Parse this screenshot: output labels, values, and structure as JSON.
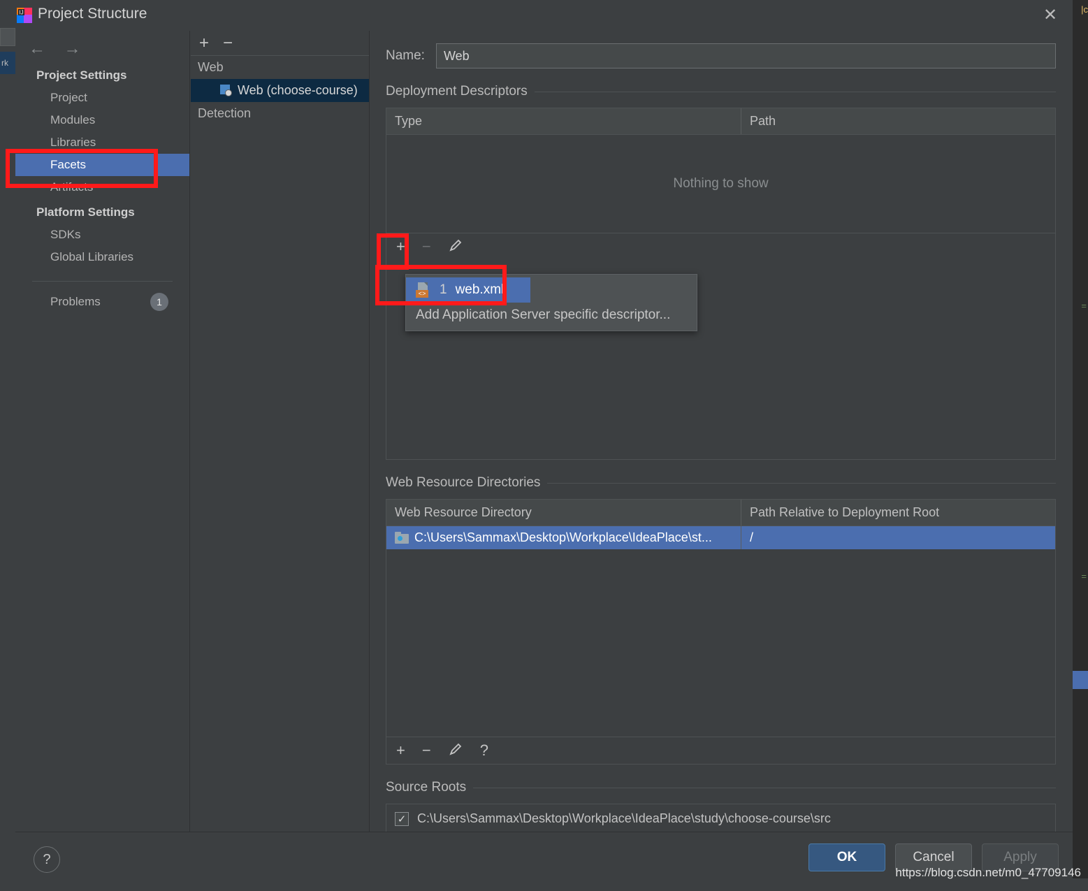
{
  "window": {
    "title": "Project Structure",
    "app_icon": "intellij-idea-icon",
    "close_icon": "close-icon"
  },
  "sidebar": {
    "nav": {
      "back_icon": "arrow-left-icon",
      "forward_icon": "arrow-right-icon"
    },
    "sections": [
      {
        "heading": "Project Settings",
        "items": [
          {
            "label": "Project",
            "selected": false
          },
          {
            "label": "Modules",
            "selected": false
          },
          {
            "label": "Libraries",
            "selected": false
          },
          {
            "label": "Facets",
            "selected": true
          },
          {
            "label": "Artifacts",
            "selected": false
          }
        ]
      },
      {
        "heading": "Platform Settings",
        "items": [
          {
            "label": "SDKs",
            "selected": false
          },
          {
            "label": "Global Libraries",
            "selected": false
          }
        ]
      }
    ],
    "problems": {
      "label": "Problems",
      "count": "1"
    }
  },
  "facet_tree": {
    "toolbar": {
      "add_label": "+",
      "remove_label": "−"
    },
    "nodes": [
      {
        "label": "Web",
        "selected": false,
        "child": false,
        "icon": ""
      },
      {
        "label": "Web (choose-course)",
        "selected": true,
        "child": true,
        "icon": "web-facet-icon"
      },
      {
        "label": "Detection",
        "selected": false,
        "child": false,
        "icon": ""
      }
    ]
  },
  "main": {
    "name_label": "Name:",
    "name_value": "Web",
    "name_placeholder": "Name",
    "deployment": {
      "title": "Deployment Descriptors",
      "columns": [
        "Type",
        "Path"
      ],
      "empty_text": "Nothing to show",
      "toolbar": {
        "add": "+",
        "remove": "−",
        "edit": "pencil-icon"
      }
    },
    "web_resources": {
      "title": "Web Resource Directories",
      "columns": [
        "Web Resource Directory",
        "Path Relative to Deployment Root"
      ],
      "rows": [
        {
          "directory": "C:\\Users\\Sammax\\Desktop\\Workplace\\IdeaPlace\\st...",
          "relative_path": "/",
          "icon": "folder-icon",
          "selected": true
        }
      ],
      "toolbar": {
        "add": "+",
        "remove": "−",
        "edit": "pencil-icon",
        "help": "?"
      }
    },
    "source_roots": {
      "title": "Source Roots",
      "rows": [
        {
          "path": "C:\\Users\\Sammax\\Desktop\\Workplace\\IdeaPlace\\study\\choose-course\\src",
          "checked": true
        }
      ]
    }
  },
  "popup": {
    "items": [
      {
        "mnemonic": "1",
        "label": "web.xml",
        "icon": "xml-file-icon",
        "highlighted": true
      },
      {
        "mnemonic": "",
        "label": "Add Application Server specific descriptor...",
        "icon": "",
        "highlighted": false
      }
    ]
  },
  "footer": {
    "help_label": "?",
    "buttons": [
      {
        "label": "OK",
        "style": "primary"
      },
      {
        "label": "Cancel",
        "style": "normal"
      },
      {
        "label": "Apply",
        "style": "disabled"
      }
    ]
  },
  "watermark": "https://blog.csdn.net/m0_47709146",
  "colors": {
    "dialog_bg": "#3c3f41",
    "selection_blue": "#4b6eaf",
    "tree_selection": "#0d2a42",
    "primary_button": "#365880",
    "annotation_red": "#ff1a1a",
    "orange_badge": "#cc7832"
  }
}
